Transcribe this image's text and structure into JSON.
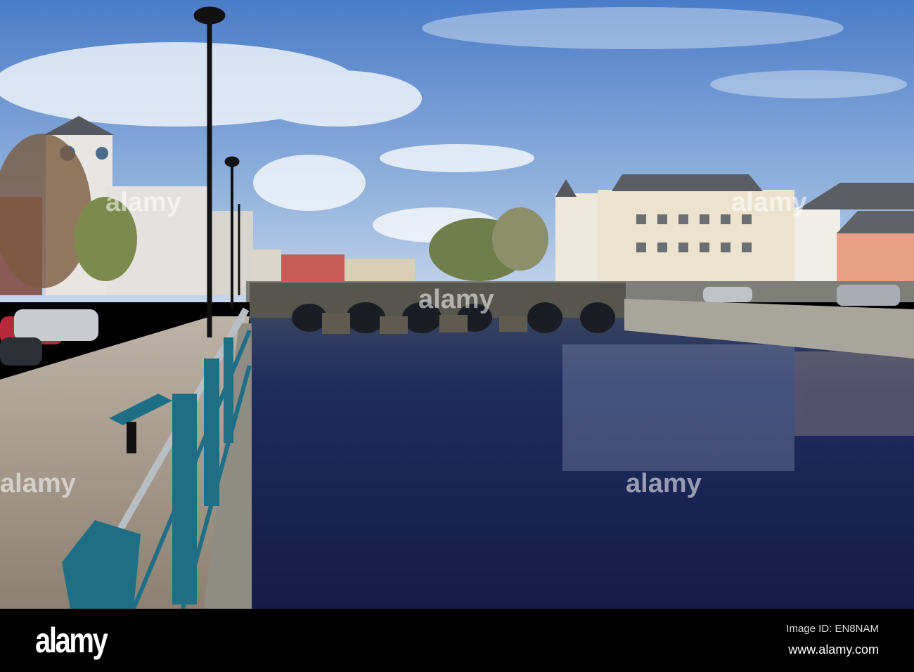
{
  "photo": {
    "subject": "river-bridge-town",
    "colors": {
      "sky_top": "#4a7cc8",
      "sky_low": "#c6d6ea",
      "water": "#1b2858",
      "railing": "#1e6f86",
      "pavement": "#a89c8c"
    }
  },
  "watermark": {
    "text": "alamy"
  },
  "footer": {
    "logo": "alamy",
    "image_id": "Image ID: EN8NAM",
    "website": "www.alamy.com"
  }
}
